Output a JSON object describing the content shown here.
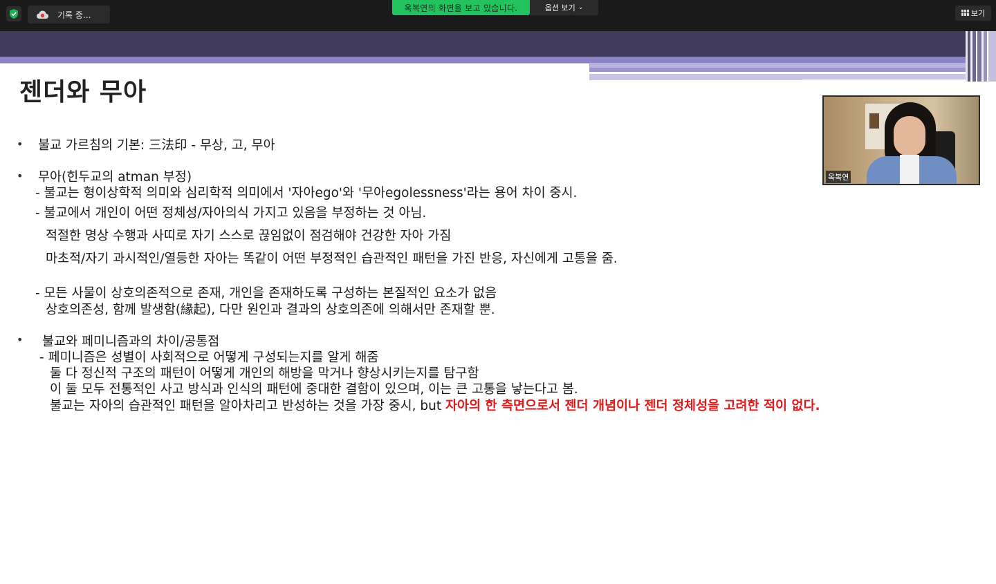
{
  "zoom": {
    "recording_label": "기록 중...",
    "viewing_banner": "옥복연의 화면을 보고 있습니다.",
    "options_label": "옵션 보기",
    "view_label": "보기",
    "colors": {
      "bar": "#1a1a1a",
      "viewing_green": "#22c35f"
    }
  },
  "slide": {
    "title": "젠더와 무아",
    "lines": {
      "b1": "불교 가르침의 기본: 三法印 - 무상, 고, 무아",
      "b2": "무아(힌두교의 atman 부정)",
      "b2_1": "- 불교는 형이상학적 의미와 심리학적 의미에서 '자아ego'와 '무아egolessness'라는 용어 차이 중시.",
      "b2_2": "- 불교에서 개인이 어떤 정체성/자아의식 가지고 있음을 부정하는 것 아님.",
      "b2_3": "적절한 명상 수행과 사띠로 자기 스스로 끊임없이 점검해야 건강한 자아 가짐",
      "b2_4": "마초적/자기 과시적인/열등한 자아는 똑같이 어떤 부정적인 습관적인 패턴을 가진 반응, 자신에게 고통을 줌.",
      "b2_5": "- 모든 사물이 상호의존적으로 존재, 개인을 존재하도록 구성하는 본질적인 요소가 없음",
      "b2_6": "상호의존성, 함께 발생함(緣起), 다만 원인과 결과의 상호의존에 의해서만 존재할 뿐.",
      "b3": "불교와 페미니즘과의 차이/공통점",
      "b3_1": "- 페미니즘은 성별이 사회적으로 어떻게 구성되는지를 알게 해줌",
      "b3_2": "둘 다 정신적 구조의 패턴이 어떻게 개인의 해방을 막거나 향상시키는지를 탐구함",
      "b3_3": "이 둘 모두 전통적인 사고 방식과 인식의 패턴에 중대한 결함이 있으며, 이는 큰 고통을 낳는다고 봄.",
      "b3_4a": "불교는 자아의 습관적인 패턴을 알아차리고 반성하는 것을 가장 중시, but ",
      "b3_4b": "자아의 한 측면으로서 젠더 개념이나 젠더 정체성을 고려한 적이 없다."
    },
    "highlight_color": "#e01b1b"
  },
  "webcam": {
    "participant_name": "옥복연"
  }
}
